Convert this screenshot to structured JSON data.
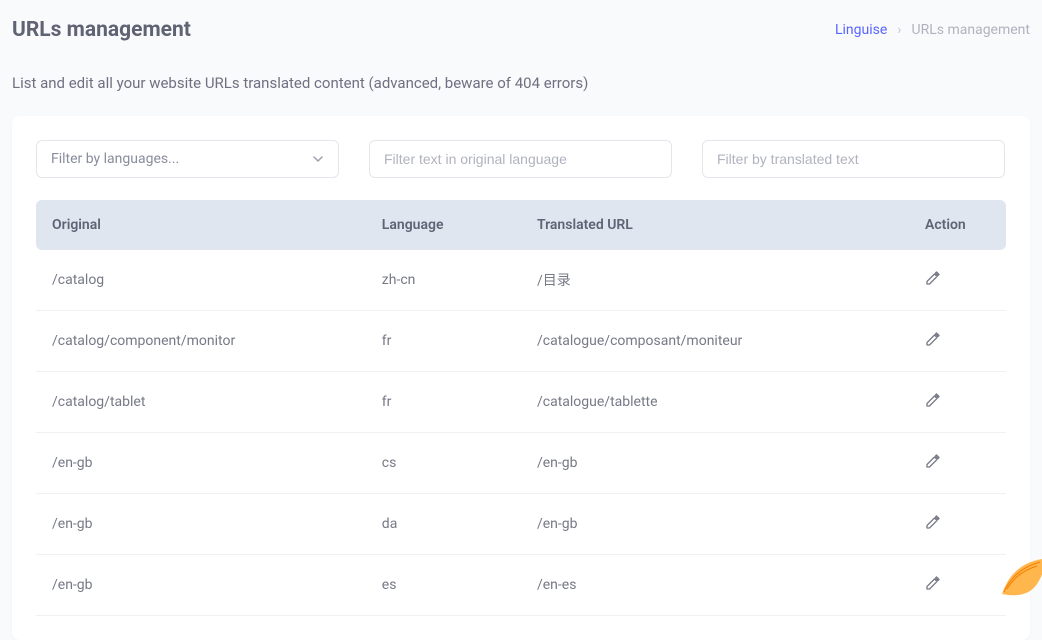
{
  "header": {
    "title": "URLs management"
  },
  "breadcrumb": {
    "link": "Linguise",
    "sep": "›",
    "current": "URLs management"
  },
  "description": "List and edit all your website URLs translated content (advanced, beware of 404 errors)",
  "filters": {
    "language_placeholder": "Filter by languages...",
    "original_placeholder": "Filter text in original language",
    "translated_placeholder": "Filter by translated text"
  },
  "table": {
    "headers": {
      "original": "Original",
      "language": "Language",
      "translated": "Translated URL",
      "action": "Action"
    },
    "rows": [
      {
        "original": "/catalog",
        "language": "zh-cn",
        "translated": "/目录"
      },
      {
        "original": "/catalog/component/monitor",
        "language": "fr",
        "translated": "/catalogue/composant/moniteur"
      },
      {
        "original": "/catalog/tablet",
        "language": "fr",
        "translated": "/catalogue/tablette"
      },
      {
        "original": "/en-gb",
        "language": "cs",
        "translated": "/en-gb"
      },
      {
        "original": "/en-gb",
        "language": "da",
        "translated": "/en-gb"
      },
      {
        "original": "/en-gb",
        "language": "es",
        "translated": "/en-es"
      }
    ]
  }
}
